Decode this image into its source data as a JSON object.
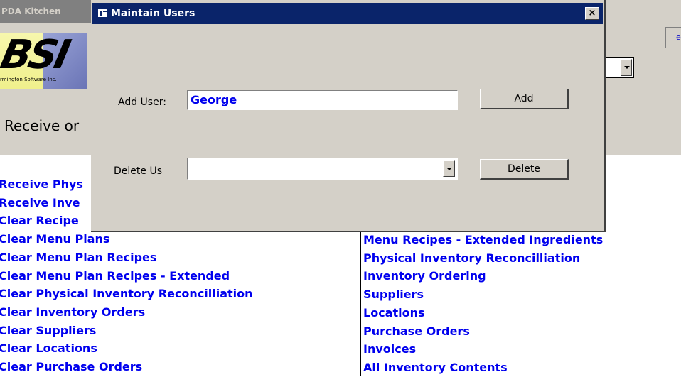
{
  "background_window": {
    "title": "PDA Kitchen",
    "logo_text": "BSI",
    "logo_subtext": "rmington Software Inc.",
    "receive_text": "Receive or",
    "right_button_text": "e"
  },
  "dialog": {
    "title": "Maintain Users",
    "close_label": "×",
    "add_user_label": "Add User:",
    "add_user_value": "George",
    "add_button_label": "Add",
    "delete_user_label": "Delete Us",
    "delete_user_value": "",
    "delete_button_label": "Delete"
  },
  "left_links": [
    "Receive Phys",
    "Receive Inve",
    "Clear Recipe",
    "Clear Menu Plans",
    "Clear Menu Plan Recipes",
    "Clear Menu Plan Recipes - Extended",
    "Clear Physical Inventory Reconcilliation",
    "Clear Inventory Orders",
    "Clear Suppliers",
    "Clear Locations",
    "Clear Purchase Orders"
  ],
  "right_links": [
    "Menu Recipes - Extended Ingredients",
    "Physical Inventory Reconcilliation",
    "Inventory Ordering",
    "Suppliers",
    "Locations",
    "Purchase Orders",
    "Invoices",
    "All Inventory Contents"
  ],
  "colors": {
    "face": "#d4d0c8",
    "title_active": "#0a246a",
    "link": "#0000ee"
  }
}
